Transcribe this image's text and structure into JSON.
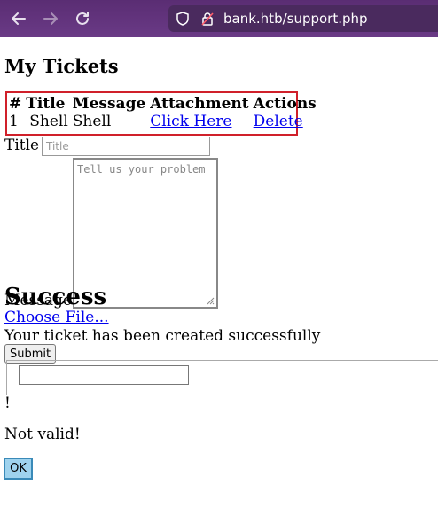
{
  "browser": {
    "url": "bank.htb/support.php"
  },
  "page": {
    "title": "My Tickets",
    "table": {
      "headers": [
        "#",
        "Title",
        "Message",
        "Attachment",
        "Actions"
      ],
      "rows": [
        {
          "id": "1",
          "title": "Shell",
          "message": "Shell",
          "attachment": "Click Here",
          "action": "Delete"
        }
      ]
    },
    "form": {
      "title_label": "Title",
      "title_placeholder": "Title",
      "message_label": "Message",
      "message_placeholder": "Tell us your problem",
      "choose_file": "Choose File...",
      "submit": "Submit"
    },
    "result": {
      "heading": "Success",
      "text": "Your ticket has been created successfully"
    },
    "dialog": {
      "mark": "!",
      "text": "Not valid!",
      "ok": "OK"
    }
  },
  "colors": {
    "toolbar": "#5a2d73",
    "highlight_border": "#d0202a",
    "link": "#0000ee",
    "ok_button": "#9fd3ee"
  }
}
